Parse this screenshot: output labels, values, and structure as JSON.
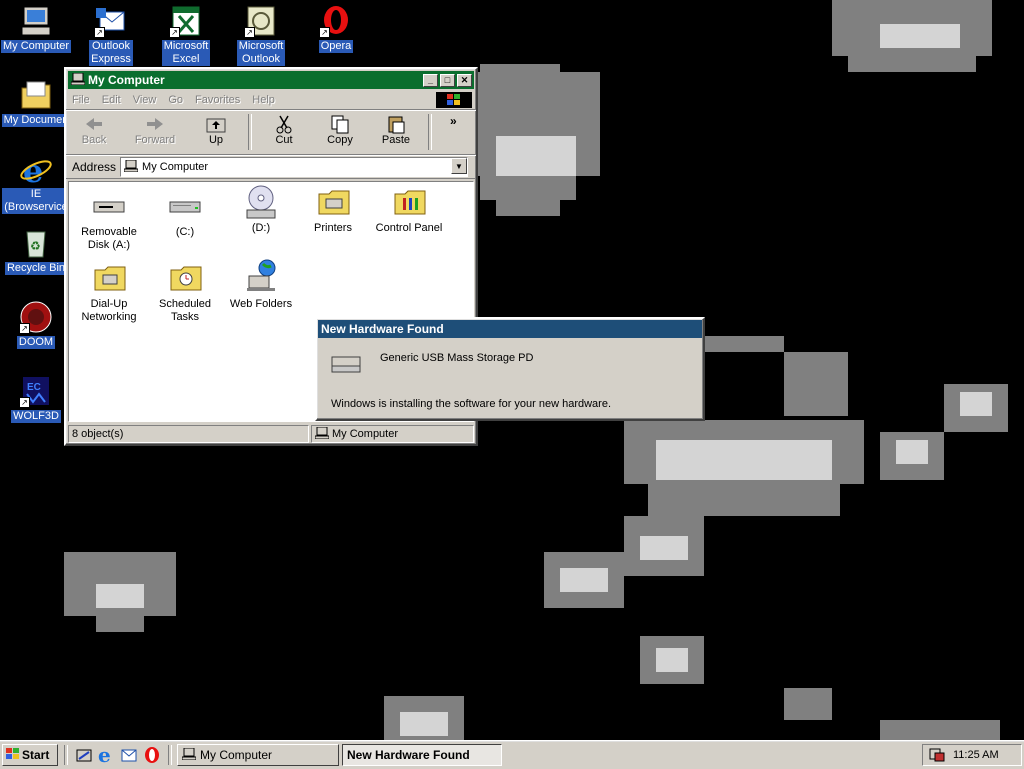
{
  "desktop": {
    "icons": [
      {
        "label": "My Computer",
        "icon": "my-computer-icon"
      },
      {
        "label": "Outlook\nExpress",
        "icon": "outlook-express-icon"
      },
      {
        "label": "Microsoft\nExcel",
        "icon": "excel-icon"
      },
      {
        "label": "Microsoft\nOutlook",
        "icon": "outlook-icon"
      },
      {
        "label": "Opera",
        "icon": "opera-icon"
      },
      {
        "label": "My Documen",
        "icon": "my-documents-icon"
      },
      {
        "label": "IE\n(Browservice",
        "icon": "ie-icon"
      },
      {
        "label": "Recycle Bin",
        "icon": "recycle-bin-icon"
      },
      {
        "label": "DOOM",
        "icon": "doom-icon"
      },
      {
        "label": "WOLF3D",
        "icon": "wolf3d-icon"
      }
    ]
  },
  "explorer": {
    "title": "My Computer",
    "menu": [
      "File",
      "Edit",
      "View",
      "Go",
      "Favorites",
      "Help"
    ],
    "toolbar": {
      "back": "Back",
      "forward": "Forward",
      "up": "Up",
      "cut": "Cut",
      "copy": "Copy",
      "paste": "Paste",
      "more": "»"
    },
    "address_label": "Address",
    "address_value": "My Computer",
    "items": [
      {
        "label": "Removable\nDisk (A:)",
        "icon": "floppy-drive-icon"
      },
      {
        "label": "(C:)",
        "icon": "hard-drive-icon"
      },
      {
        "label": "(D:)",
        "icon": "cd-drive-icon"
      },
      {
        "label": "Printers",
        "icon": "printers-folder-icon"
      },
      {
        "label": "Control Panel",
        "icon": "control-panel-folder-icon"
      },
      {
        "label": "Dial-Up\nNetworking",
        "icon": "dialup-networking-folder-icon"
      },
      {
        "label": "Scheduled\nTasks",
        "icon": "scheduled-tasks-folder-icon"
      },
      {
        "label": "Web Folders",
        "icon": "web-folders-icon"
      }
    ],
    "status_count": "8 object(s)",
    "status_location": "My Computer"
  },
  "notification": {
    "title": "New Hardware Found",
    "device": "Generic USB Mass Storage PD",
    "message": "Windows is installing the software for your new hardware."
  },
  "taskbar": {
    "start": "Start",
    "tasks": [
      "My Computer",
      "New Hardware Found"
    ],
    "clock": "11:25 AM"
  },
  "colors": {
    "active_title": "#0a6e2e",
    "inactive_title": "#1e4e78",
    "desktop_bg": "#000000",
    "face": "#d4d0c8"
  }
}
